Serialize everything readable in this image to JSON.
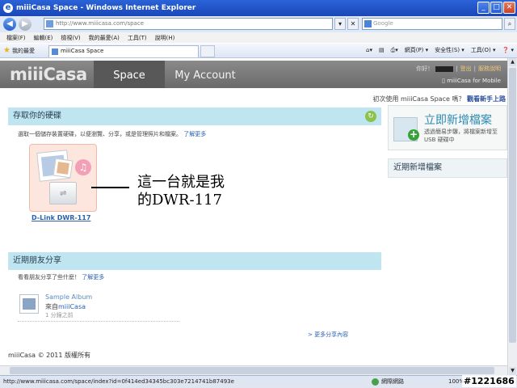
{
  "window": {
    "title": "miiiCasa Space - Windows Internet Explorer",
    "app_icon": "ie-icon",
    "buttons": {
      "minimize": "_",
      "maximize": "□",
      "close": "✕"
    }
  },
  "addressbar": {
    "url": "http://www.miiicasa.com/space",
    "search_placeholder": "Google"
  },
  "menubar": {
    "items": [
      "檔案(F)",
      "編輯(E)",
      "檢視(V)",
      "我的最愛(A)",
      "工具(T)",
      "說明(H)"
    ]
  },
  "favorites": {
    "label": "我的最愛",
    "tab_title": "miiiCasa Space",
    "commands": [
      "網頁(P) ▾",
      "安全性(S) ▾",
      "工具(O) ▾",
      "❓ ▾"
    ]
  },
  "site": {
    "logo": "miiiCasa",
    "tabs": {
      "space": "Space",
      "account": "My Account"
    },
    "greeting": "你好！",
    "logout": "登出",
    "help": "服務說明",
    "mobile": "miiiCasa for Mobile",
    "first_time": "初次使用 miiiCasa Space 嗎？",
    "tour": "觀看新手上路"
  },
  "storage": {
    "heading": "存取你的硬碟",
    "description": "選取一個儲存裝置硬碟，以便瀏覽、分享，或是管理照片和檔案。",
    "more": "了解更多",
    "device_name": "D-Link DWR-117",
    "annotation_line1": "這一台就是我",
    "annotation_line2": "的DWR-117"
  },
  "friends": {
    "heading": "近期朋友分享",
    "description": "看看朋友分享了些什麼！",
    "more": "了解更多",
    "album_title": "Sample Album",
    "album_from_label": "來自",
    "album_from_source": "miiiCasa",
    "album_time": "1 分鐘之前",
    "more_shares": "> 更多分享內容"
  },
  "sidebar": {
    "quick_add_title": "立即新增檔案",
    "quick_add_desc": "透過簡易步驟，將檔案新增至 USB 硬碟中",
    "recent_added": "近期新增檔案"
  },
  "footer": {
    "copyright": "miiiCasa © 2011  版權所有"
  },
  "statusbar": {
    "url": "http://www.miiicasa.com/space/index?id=0f414ed34345bc303e7214741b87493e",
    "zone": "網際網路",
    "zoom": "100%",
    "watermark": "#1221686"
  }
}
